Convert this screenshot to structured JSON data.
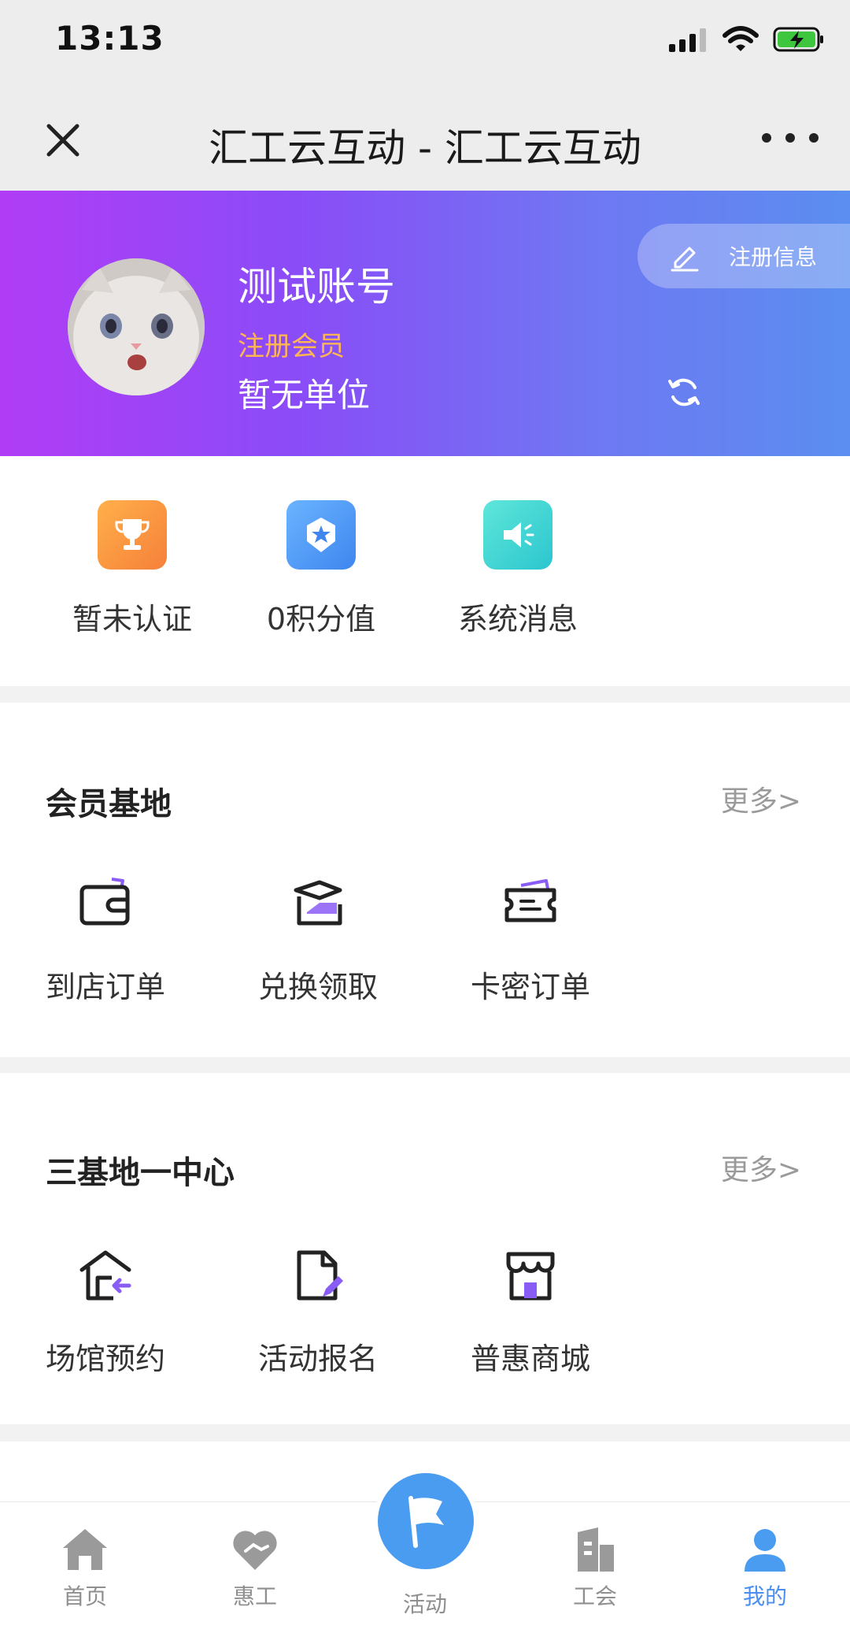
{
  "status_bar": {
    "time": "13:13"
  },
  "nav": {
    "title": "汇工云互动 - 汇工云互动"
  },
  "profile": {
    "name": "测试账号",
    "role": "注册会员",
    "unit": "暂无单位",
    "register_label": "注册信息",
    "colors": {
      "gradient_start": "#b13cf6",
      "gradient_end": "#5b8ef0",
      "role_color": "#ffb552"
    }
  },
  "stats": [
    {
      "label": "暂未认证",
      "icon": "trophy-icon"
    },
    {
      "label": "0积分值",
      "icon": "medal-star-icon"
    },
    {
      "label": "系统消息",
      "icon": "speaker-icon"
    }
  ],
  "member_base": {
    "title": "会员基地",
    "more": "更多>",
    "items": [
      {
        "label": "到店订单",
        "icon": "wallet-icon"
      },
      {
        "label": "兑换领取",
        "icon": "exchange-icon"
      },
      {
        "label": "卡密订单",
        "icon": "ticket-icon"
      }
    ]
  },
  "centers": {
    "title": "三基地一中心",
    "more": "更多>",
    "items": [
      {
        "label": "场馆预约",
        "icon": "venue-icon"
      },
      {
        "label": "活动报名",
        "icon": "document-edit-icon"
      },
      {
        "label": "普惠商城",
        "icon": "store-icon"
      }
    ]
  },
  "tabs": [
    {
      "label": "首页",
      "icon": "home-icon"
    },
    {
      "label": "惠工",
      "icon": "heart-hand-icon"
    },
    {
      "label": "活动",
      "icon": "flag-icon"
    },
    {
      "label": "工会",
      "icon": "building-icon"
    },
    {
      "label": "我的",
      "icon": "person-icon",
      "active": true
    }
  ],
  "accent_color": "#4a8ff0"
}
